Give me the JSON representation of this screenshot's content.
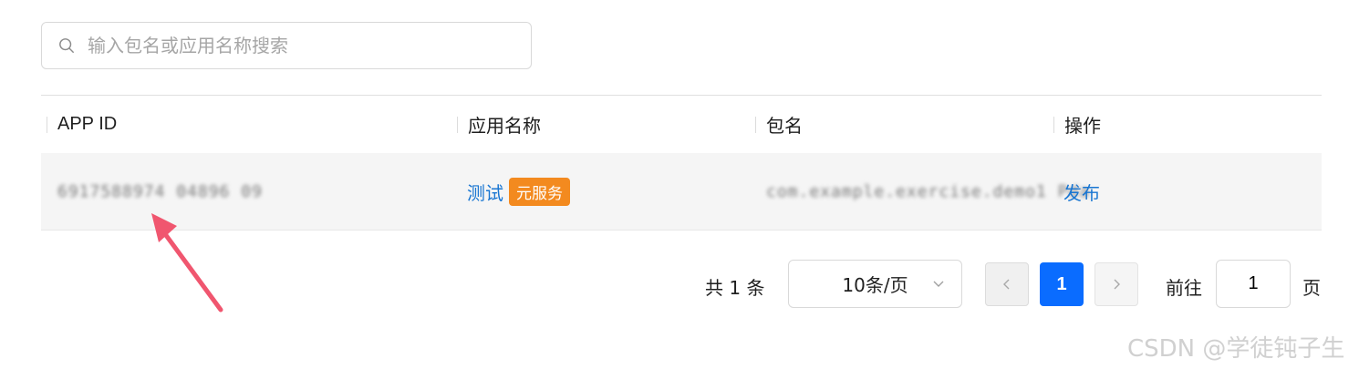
{
  "search": {
    "placeholder": "输入包名或应用名称搜索",
    "value": ""
  },
  "table": {
    "columns": [
      "APP ID",
      "应用名称",
      "包名",
      "操作"
    ],
    "rows": [
      {
        "app_id": "6917588974 04896 09",
        "app_name": "测试",
        "tag": "元服务",
        "package": "com.example.exercise.demo1 Pda",
        "action": "发布"
      }
    ]
  },
  "pagination": {
    "total_text": "共 1 条",
    "page_size": "10条/页",
    "current_page": "1",
    "goto_label": "前往",
    "goto_value": "1",
    "page_unit": "页"
  },
  "watermark": "CSDN @学徒钝子生",
  "colors": {
    "link": "#1976d2",
    "tag": "#f38a1f",
    "current_page": "#0a6cff",
    "arrow": "#f0566f"
  }
}
